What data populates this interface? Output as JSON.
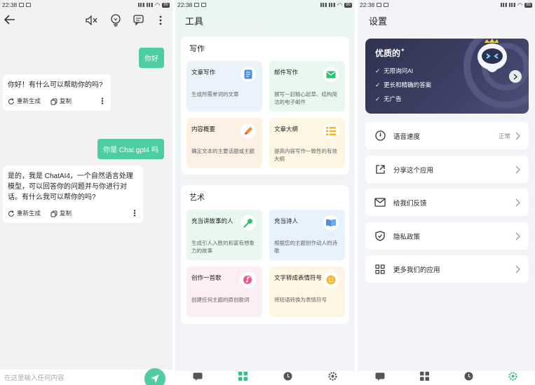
{
  "status": {
    "time": "22:38"
  },
  "chat": {
    "user_msg_1": "你好",
    "bot_msg_1": "你好！有什么可以帮助你的吗?",
    "regenerate_label": "重新生成",
    "copy_label": "复制",
    "user_msg_2": "你是 Chat gpt4 吗",
    "bot_msg_2": "是的，我是 ChatAI4，一个自然语言处理模型，可以回答你的问题并与你进行对话。有什么我可以帮你的吗?",
    "input_placeholder": "在这里输入任何内容"
  },
  "tools": {
    "title": "工具",
    "writing": {
      "title": "写作",
      "cards": [
        {
          "title": "文章写作",
          "desc": "生成所需单词的文章"
        },
        {
          "title": "邮件写作",
          "desc": "撰写一封精心起草、结构简洁的电子邮件"
        },
        {
          "title": "内容概要",
          "desc": "确定文本的主要话题或主题"
        },
        {
          "title": "文章大纲",
          "desc": "提高内容写作一致性的有效大纲"
        }
      ]
    },
    "art": {
      "title": "艺术",
      "cards": [
        {
          "title": "充当讲故事的人",
          "desc": "生成引人入胜的和富有想象力的故事"
        },
        {
          "title": "充当诗人",
          "desc": "根据您的主题创作动人的诗歌"
        },
        {
          "title": "创作一首歌",
          "desc": "创建任何主题的原创歌词"
        },
        {
          "title": "文字转成表情符号",
          "desc": "将短语转换为表情符号"
        }
      ]
    }
  },
  "settings": {
    "title": "设置",
    "premium": {
      "title": "优质的",
      "features": [
        "无限询问AI",
        "更长和精确的答案",
        "无广告"
      ]
    },
    "rows": [
      {
        "label": "语音速度",
        "value": "正常"
      },
      {
        "label": "分享这个应用"
      },
      {
        "label": "给我们反馈"
      },
      {
        "label": "隐私政策"
      },
      {
        "label": "更多我们的应用"
      }
    ]
  },
  "colors": {
    "accent": "#4ecca3",
    "premium_bg": "#3c3f63"
  }
}
